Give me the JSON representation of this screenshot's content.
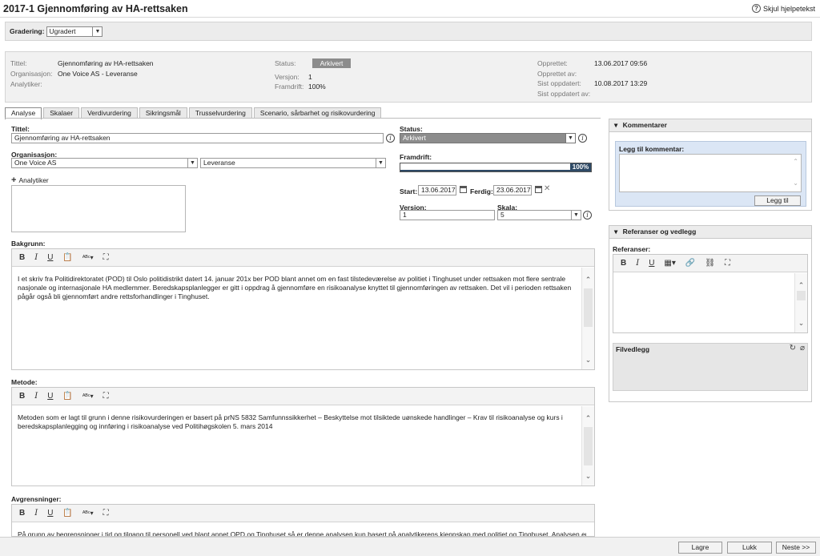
{
  "window": {
    "title": "2017-1 Gjennomføring av HA-rettsaken",
    "help_label": "Skjul hjelpetekst"
  },
  "gradering": {
    "label": "Gradering:",
    "value": "Ugradert"
  },
  "info": {
    "tittel_label": "Tittel:",
    "tittel_value": "Gjennomføring av HA-rettsaken",
    "org_label": "Organisasjon:",
    "org_value": "One Voice AS - Leveranse",
    "analytiker_label": "Analytiker:",
    "status_label": "Status:",
    "status_value": "Arkivert",
    "versjon_label": "Versjon:",
    "versjon_value": "1",
    "framdrift_label": "Framdrift:",
    "framdrift_value": "100%",
    "opprettet_label": "Opprettet:",
    "opprettet_value": "13.06.2017 09:56",
    "opprettet_av_label": "Opprettet av:",
    "sist_oppdatert_label": "Sist oppdatert:",
    "sist_oppdatert_value": "10.08.2017 13:29",
    "sist_oppdatert_av_label": "Sist oppdatert av:"
  },
  "tabs": [
    "Analyse",
    "Skalaer",
    "Verdivurdering",
    "Sikringsmål",
    "Trusselvurdering",
    "Scenario, sårbarhet og risikovurdering"
  ],
  "form": {
    "tittel_label": "Tittel:",
    "tittel_value": "Gjennomføring av HA-rettsaken",
    "org_label": "Organisasjon:",
    "org_value": "One Voice AS",
    "org_sub_value": "Leveranse",
    "add_analytiker_label": "Analytiker",
    "status_label": "Status:",
    "status_value": "Arkivert",
    "framdrift_label": "Framdrift:",
    "framdrift_value": "100%",
    "framdrift_fraction": 1.0,
    "start_label": "Start:",
    "start_value": "13.06.2017",
    "ferdig_label": "Ferdig:",
    "ferdig_value": "23.06.2017",
    "versjon_label": "Versjon:",
    "versjon_value": "1",
    "skala_label": "Skala:",
    "skala_value": "5"
  },
  "editors": {
    "bakgrunn": {
      "label": "Bakgrunn:",
      "text": "I et skriv fra Politidirektoratet (POD) til Oslo politidistrikt datert 14. januar 201x ber POD blant annet om en fast tilstedeværelse av politiet i Tinghuset under rettsaken mot flere sentrale nasjonale og internasjonale HA medlemmer. Beredskapsplanlegger er gitt i oppdrag å gjennomføre en risikoanalyse knyttet til gjennomføringen av rettsaken. Det vil i perioden rettsaken pågår også bli gjennomført andre rettsforhandlinger i Tinghuset."
    },
    "metode": {
      "label": "Metode:",
      "text": "Metoden som er lagt til grunn i denne risikovurderingen er basert på prNS 5832 Samfunnssikkerhet – Beskyttelse mot tilsiktede uønskede handlinger – Krav til risikoanalyse og kurs i beredskapsplanlegging og innføring i risikoanalyse ved Politihøgskolen 5. mars 2014"
    },
    "avgrensninger": {
      "label": "Avgrensninger:",
      "text": "På grunn av begrensninger i tid og tilgang til personell ved blant annet OPD og Tinghuset så er denne analysen kun basert på analytikerens kjennskap med politiet og Tinghuset. Analysen er"
    }
  },
  "kommentarer": {
    "title": "Kommentarer",
    "add_label": "Legg til kommentar:",
    "add_button": "Legg til"
  },
  "referanser": {
    "title": "Referanser og vedlegg",
    "ref_label": "Referanser:",
    "filvedlegg_label": "Filvedlegg"
  },
  "footer": {
    "lagre": "Lagre",
    "lukk": "Lukk",
    "neste": "Neste >>"
  }
}
